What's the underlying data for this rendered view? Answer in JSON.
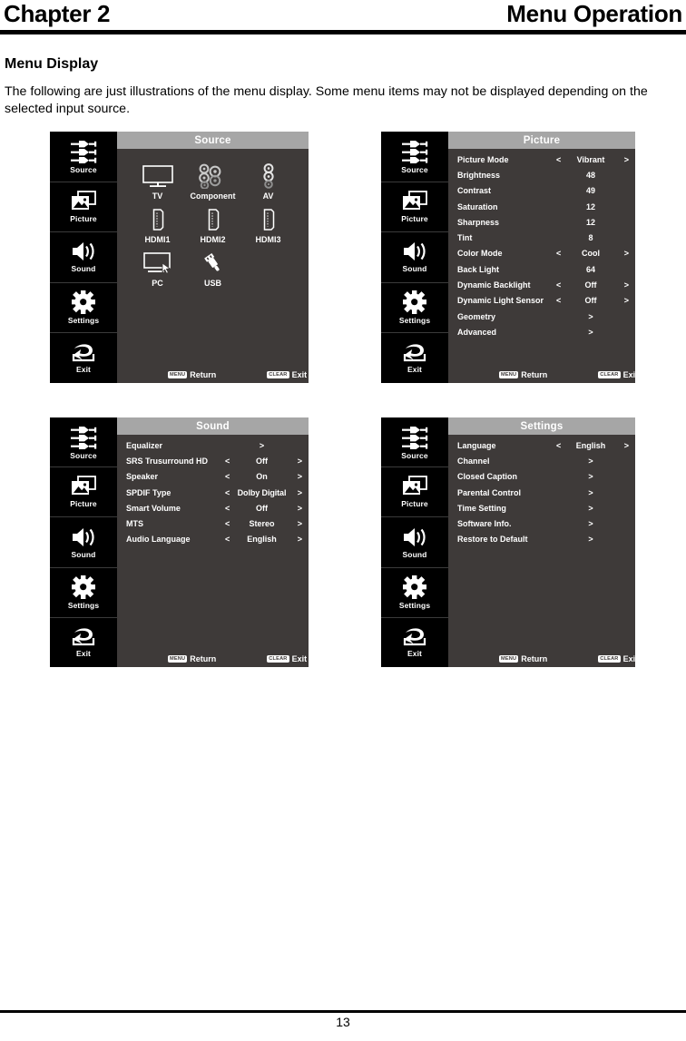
{
  "header": {
    "chapter": "Chapter 2",
    "section": "Menu Operation"
  },
  "content": {
    "title": "Menu Display",
    "paragraph": "The following are just illustrations of the menu display. Some menu items may not be displayed depending on the selected input source."
  },
  "footer": {
    "page_number": "13"
  },
  "colors": {
    "panel_bg": "#3e3a39",
    "sidebar_bg": "#000000",
    "title_bar": "#a6a6a6",
    "text": "#ffffff"
  },
  "osd_common": {
    "sidebar": [
      {
        "label": "Source",
        "icon": "rca-connectors-icon"
      },
      {
        "label": "Picture",
        "icon": "photos-icon"
      },
      {
        "label": "Sound",
        "icon": "speaker-icon"
      },
      {
        "label": "Settings",
        "icon": "gear-icon"
      },
      {
        "label": "Exit",
        "icon": "return-arrow-icon"
      }
    ],
    "footer": {
      "return_key": "MENU",
      "return_label": "Return",
      "exit_key": "CLEAR",
      "exit_label": "Exit"
    }
  },
  "panels": {
    "source": {
      "title": "Source",
      "items": [
        {
          "label": "TV",
          "icon": "tv-icon"
        },
        {
          "label": "Component",
          "icon": "component-jacks-icon"
        },
        {
          "label": "AV",
          "icon": "av-jacks-icon"
        },
        {
          "label": "HDMI1",
          "icon": "hdmi-port-icon"
        },
        {
          "label": "HDMI2",
          "icon": "hdmi-port-icon"
        },
        {
          "label": "HDMI3",
          "icon": "hdmi-port-icon"
        },
        {
          "label": "PC",
          "icon": "pc-monitor-icon"
        },
        {
          "label": "USB",
          "icon": "usb-plug-icon"
        }
      ]
    },
    "picture": {
      "title": "Picture",
      "rows": [
        {
          "name": "Picture Mode",
          "value": "Vibrant",
          "left": "<",
          "right": ">"
        },
        {
          "name": "Brightness",
          "value": "48",
          "left": "",
          "right": ""
        },
        {
          "name": "Contrast",
          "value": "49",
          "left": "",
          "right": ""
        },
        {
          "name": "Saturation",
          "value": "12",
          "left": "",
          "right": ""
        },
        {
          "name": "Sharpness",
          "value": "12",
          "left": "",
          "right": ""
        },
        {
          "name": "Tint",
          "value": "8",
          "left": "",
          "right": ""
        },
        {
          "name": "Color Mode",
          "value": "Cool",
          "left": "<",
          "right": ">"
        },
        {
          "name": "Back Light",
          "value": "64",
          "left": "",
          "right": ""
        },
        {
          "name": "Dynamic Backlight",
          "value": "Off",
          "left": "<",
          "right": ">"
        },
        {
          "name": "Dynamic Light Sensor",
          "value": "Off",
          "left": "<",
          "right": ">"
        },
        {
          "name": "Geometry",
          "value": ">",
          "left": "",
          "right": ""
        },
        {
          "name": "Advanced",
          "value": ">",
          "left": "",
          "right": ""
        }
      ]
    },
    "sound": {
      "title": "Sound",
      "rows": [
        {
          "name": "Equalizer",
          "value": ">",
          "left": "",
          "right": ""
        },
        {
          "name": "SRS Trusurround HD",
          "value": "Off",
          "left": "<",
          "right": ">"
        },
        {
          "name": "Speaker",
          "value": "On",
          "left": "<",
          "right": ">"
        },
        {
          "name": "SPDIF Type",
          "value": "Dolby Digital",
          "left": "<",
          "right": ">"
        },
        {
          "name": "Smart Volume",
          "value": "Off",
          "left": "<",
          "right": ">"
        },
        {
          "name": "MTS",
          "value": "Stereo",
          "left": "<",
          "right": ">"
        },
        {
          "name": "Audio Language",
          "value": "English",
          "left": "<",
          "right": ">"
        }
      ]
    },
    "settings": {
      "title": "Settings",
      "rows": [
        {
          "name": "Language",
          "value": "English",
          "left": "<",
          "right": ">"
        },
        {
          "name": "Channel",
          "value": ">",
          "left": "",
          "right": ""
        },
        {
          "name": "Closed Caption",
          "value": ">",
          "left": "",
          "right": ""
        },
        {
          "name": "Parental Control",
          "value": ">",
          "left": "",
          "right": ""
        },
        {
          "name": "Time Setting",
          "value": ">",
          "left": "",
          "right": ""
        },
        {
          "name": "Software Info.",
          "value": ">",
          "left": "",
          "right": ""
        },
        {
          "name": "Restore to Default",
          "value": ">",
          "left": "",
          "right": ""
        }
      ]
    }
  }
}
